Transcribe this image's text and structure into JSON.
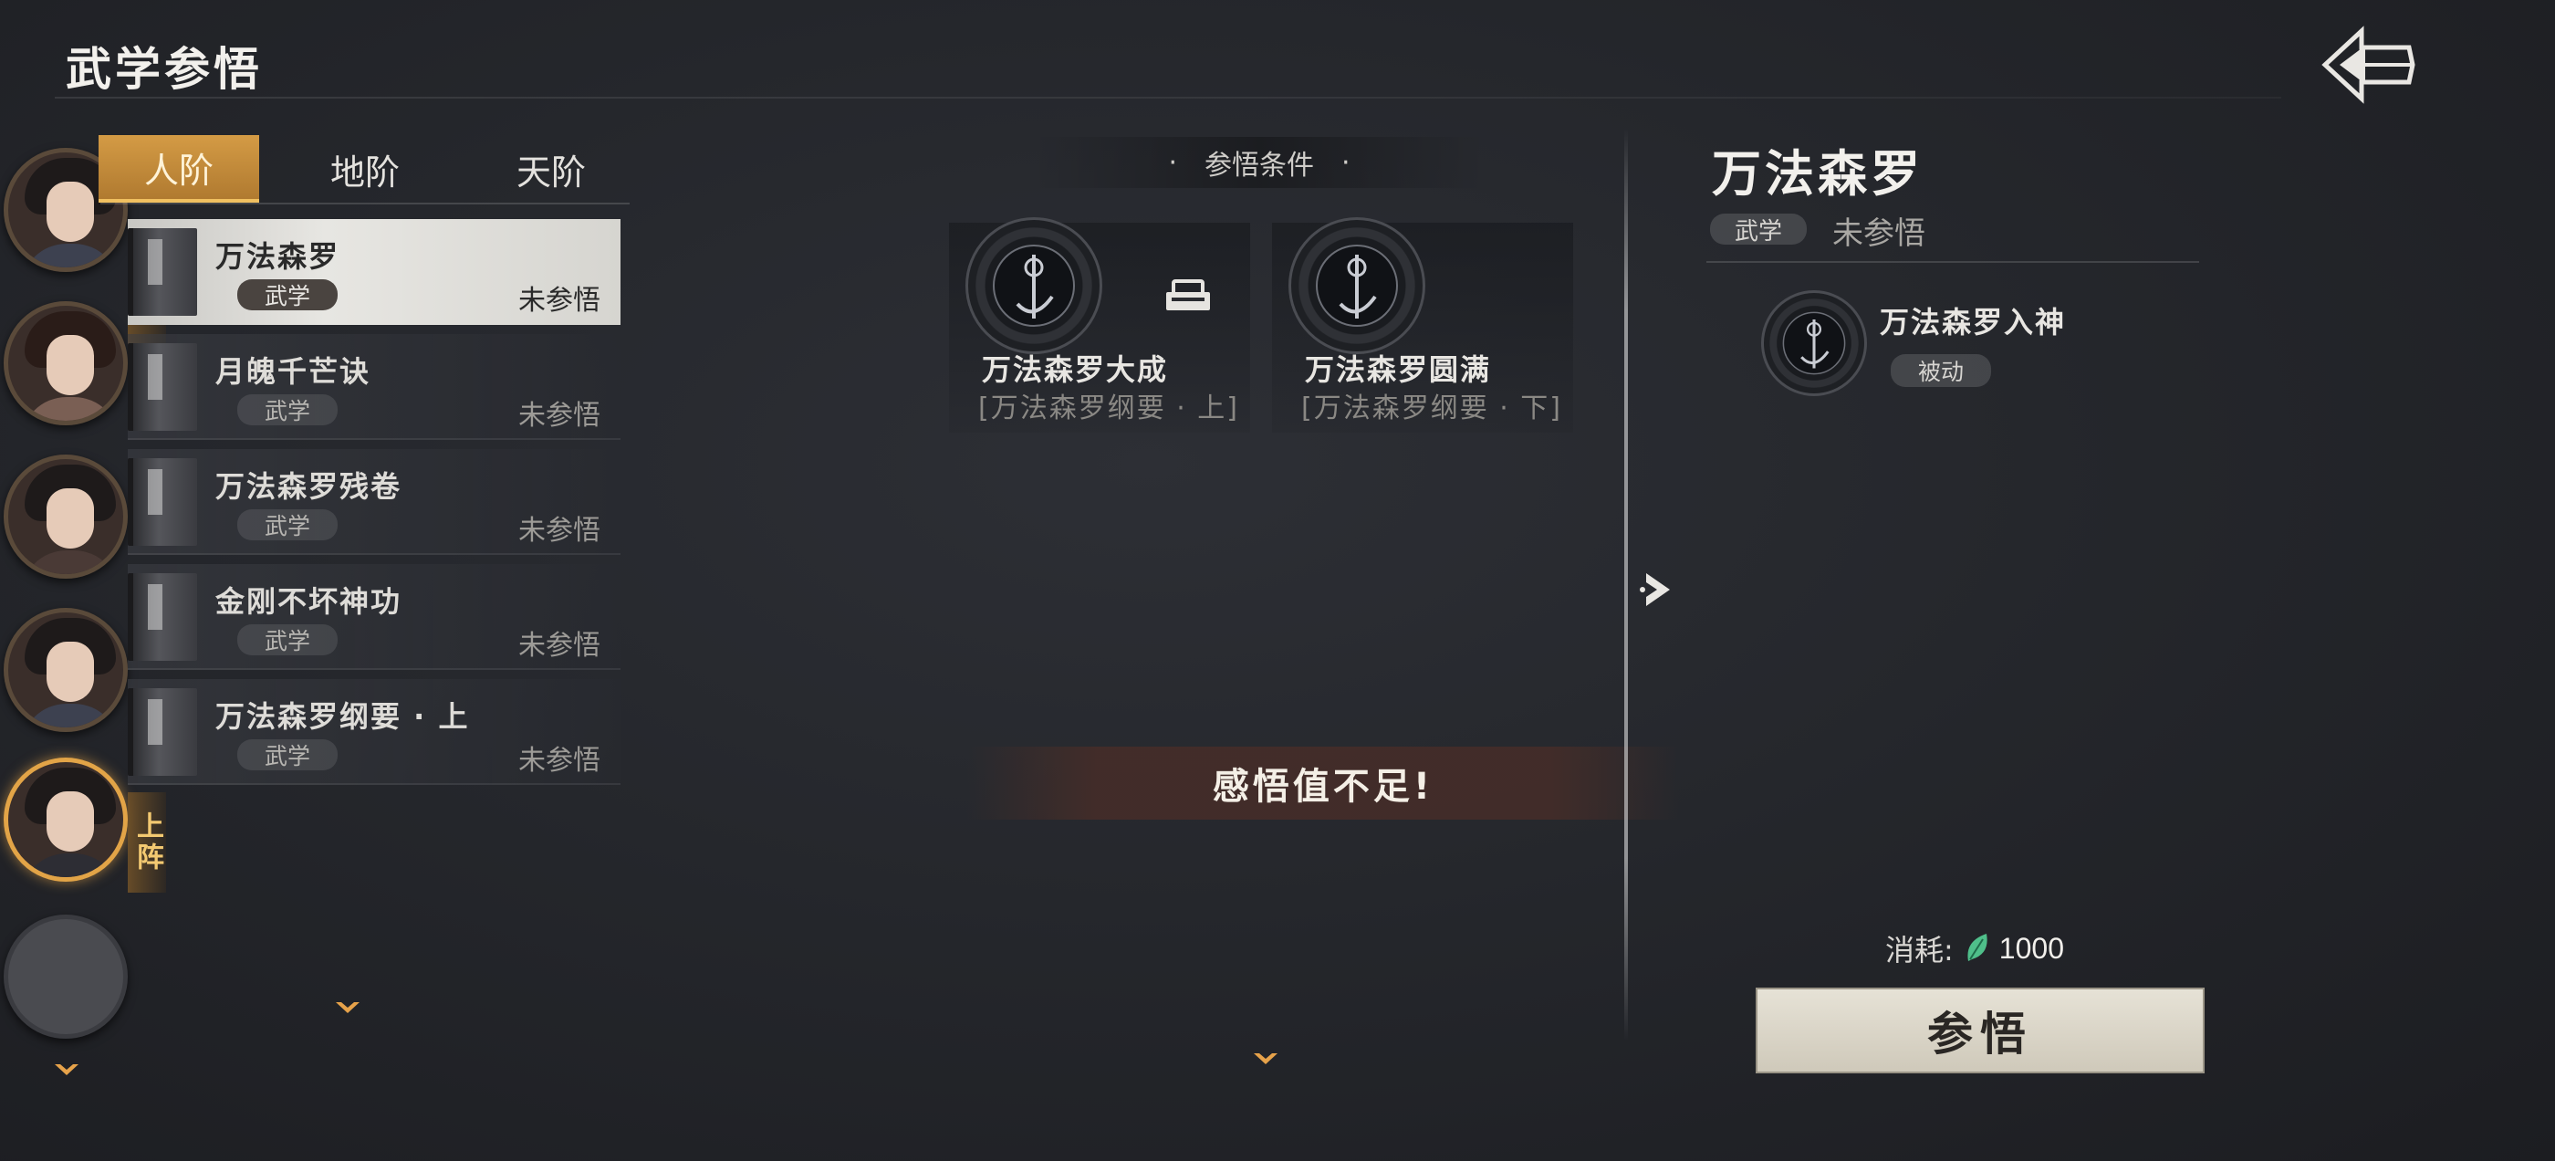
{
  "header": {
    "title": "武学参悟"
  },
  "characters": [
    {
      "name": "character-1",
      "deployed": false
    },
    {
      "name": "character-2",
      "deployed": true,
      "tag": "上阵"
    },
    {
      "name": "character-3",
      "deployed": false
    },
    {
      "name": "character-4",
      "deployed": false
    },
    {
      "name": "character-5",
      "deployed": true,
      "tag": "上阵",
      "active": true
    },
    {
      "name": "character-empty",
      "empty": true
    }
  ],
  "tabs": [
    {
      "label": "人阶",
      "active": true
    },
    {
      "label": "地阶",
      "active": false
    },
    {
      "label": "天阶",
      "active": false
    }
  ],
  "skills": [
    {
      "name": "万法森罗",
      "tag": "武学",
      "state": "未参悟",
      "selected": true
    },
    {
      "name": "月魄千芒诀",
      "tag": "武学",
      "state": "未参悟"
    },
    {
      "name": "万法森罗残卷",
      "tag": "武学",
      "state": "未参悟"
    },
    {
      "name": "金刚不坏神功",
      "tag": "武学",
      "state": "未参悟"
    },
    {
      "name": "万法森罗纲要 · 上",
      "tag": "武学",
      "state": "未参悟"
    }
  ],
  "conditions": {
    "title": "参悟条件",
    "dot": "·",
    "items": [
      {
        "name": "万法森罗大成",
        "sub": "[万法森罗纲要 · 上]",
        "locked": true
      },
      {
        "name": "万法森罗圆满",
        "sub": "[万法森罗纲要 · 下]",
        "locked": false
      }
    ]
  },
  "toast": "感悟值不足!",
  "detail": {
    "name": "万法森罗",
    "tag": "武学",
    "state": "未参悟",
    "passive": {
      "name": "万法森罗入神",
      "tag": "被动"
    },
    "cost_label": "消耗:",
    "cost_value": "1000",
    "button": "参悟"
  },
  "colors": {
    "accent": "#d49b45",
    "toast_bg": "#46302a",
    "cost_leaf": "#4fbf8a"
  }
}
